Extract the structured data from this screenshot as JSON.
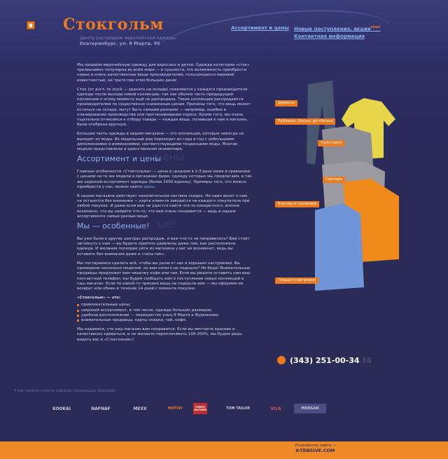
{
  "header": {
    "logo": "Стокгольм",
    "address_line1": "Центр распродаж европейской одежды",
    "address_line2": "Екатеринбург, ул. 8 Марта, 95"
  },
  "nav": [
    {
      "label": "Ассортимент и цены"
    },
    {
      "label": "Новые поступления, акции",
      "badge": "new!"
    },
    {
      "label": "Контактная информация"
    }
  ],
  "intro": [
    "Мы продаём европейскую одежду для взрослых и детей. Одежда категории «сток» чрезвычайно популярна во всём мире — в сущности, это возможность приобрести новые и очень качественные вещи производителей, пользующихся мировой известностью, не тратя при этом больших денег.",
    "Сток (от англ. to stock — хранить на складе) появляется у каждого производителя одежды после выхода новой коллекции, так как обычно часть предыдущей коллекции к этому моменту ещё не распродана. Такие коллекции распродаются производителем по существенно сниженным ценам. Причины того, что вещь может остаться на складе, могут быть самыми разными — например, ошибки в планировании производства или прогнозировании спроса. Кроме того, мы очень тщательно относимся к отбору товара — каждая вещь, попавшая к нам в магазин, была отобрана вручную.",
    "Большая часть одежды в нашем магазине — это коллекции, которые никогда не выходят из моды. Их модельный ряд переходит из года в год с небольшими дополнениями и изменениями, соответствующими тенденциям моды. Многие модели представлены в единственном экземпляре."
  ],
  "section1": {
    "title": "Ассортимент и цены",
    "ghost": "цены",
    "p1": "Главные особенности «Стокгольма» — цены в среднем в 2-3 раза ниже в сравнении с ценами на те же модели в магазинах фирм, одежду которых мы предлагаем, а так же широкий ассортимент одежды (более 1000 единиц). Примеры того, что можно приобрести у нас, можно найти",
    "link": "здесь",
    "p2": "В нашем магазине действует накопительная система скидок. Ни один визит к нам не останется без внимания — карта клиента заводится на каждого покупателя при любой покупке. И даже если вам не удастся найти что-то конкретного, вполне возможно, что вы найдёте что-то, что вам очень понравится — ведь в нашем ассортименте самые разные вещи."
  },
  "section2": {
    "title": "Мы — особенные!",
    "ghost": "ые!",
    "p1": "Вы уже были в других центрах распродаж, и вам что-то не понравилось? Вам стоит заглянуть к нам — вы будете приятно удивлены даже тем, как расположена одежда. И желание поскорее уйти из магазина у вас не возникнет, ведь вы оставить без внимания даже в «часы пик».",
    "p2": "Мы постараемся сделать всё, чтобы вы ушли от нас в хорошем настроении. Вы примерили несколько моделей, но вам ничего не подошло? Не беда! Внимательные продавцы предложат вам чашечку кофе или чая. Если вы решите оставить нам ваш контактный телефон, мы будем сообщать вам о поступлении новых коллекций в наш магазин. Если по какой-то причине вещь не подошла вам — мы оформим ее возврат или обмен в течение 14 дней с момента покупки.",
    "list_title": "«Стокгольм» — это:",
    "items": [
      "привлекательные цены;",
      "широкий ассортимент, в том числе, одежда больших размеров;",
      "удобное расположение — перекресток улиц 8 Марта и Фурманова;",
      "внимательные продавцы, карты скидки, чай, кофе."
    ],
    "p3": "Мы надеемся, что наш магазин вам понравится. Если вы мечтаете красиво и качественно одеваться, и не желаете переплачивать 100-200%, мы будем рады видеть вас в «Стокгольме»!"
  },
  "categories": [
    {
      "label": "Джинсы"
    },
    {
      "label": "Рубашки, блузы, футболки"
    },
    {
      "label": "Толстовки"
    },
    {
      "label": "Свитера"
    },
    {
      "label": "Куртки и пуховики"
    },
    {
      "label": "Плащи и ветровки"
    }
  ],
  "phone": {
    "number": "(343) 251-00-34",
    "ghost": "34"
  },
  "brands": {
    "title": "У нас можно купить одежду следующих брендов:",
    "items": [
      "KOOKAI",
      "NAFNAF",
      "MEXX",
      "MOTIVI",
      "TOMMY HILFIGER",
      "TOM TAILOR",
      "VILA",
      "MORGAN"
    ]
  },
  "footer": {
    "line1": "Разработка сайта —",
    "line2": "X-TENSIVE.COM"
  },
  "colors": {
    "accent": "#ee7a1f",
    "link": "#8fb1f0",
    "background": "#2a2b57"
  }
}
